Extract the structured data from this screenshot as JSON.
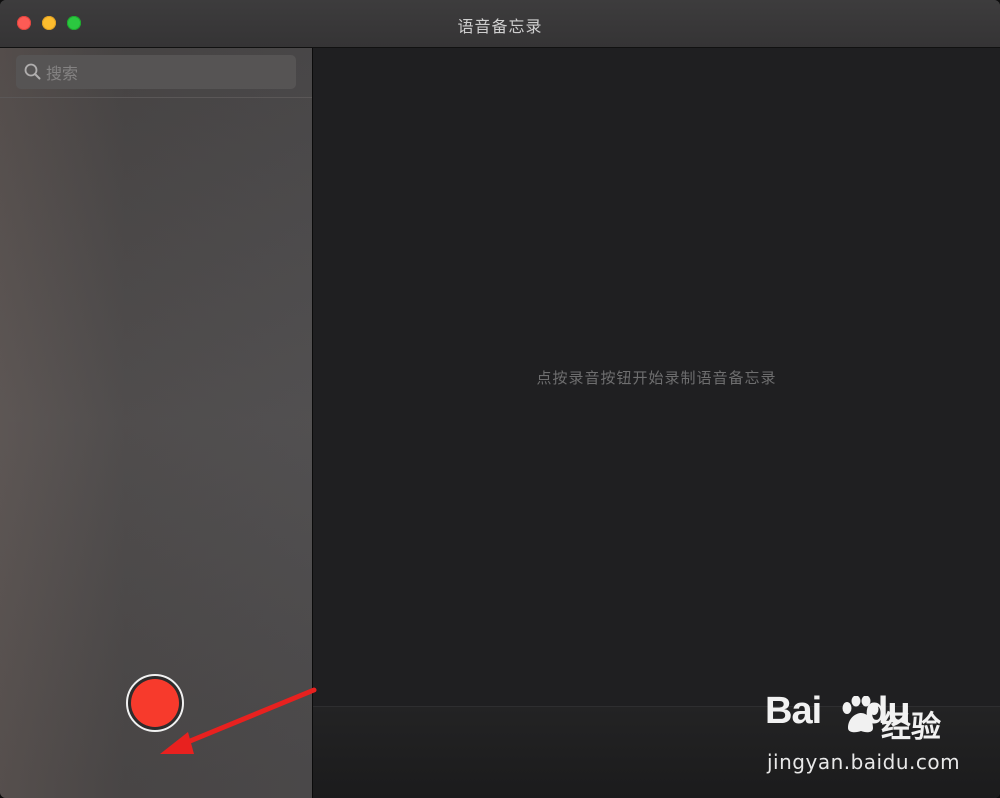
{
  "window": {
    "title": "语音备忘录"
  },
  "sidebar": {
    "search": {
      "placeholder": "搜索",
      "value": ""
    }
  },
  "main": {
    "empty_message": "点按录音按钮开始录制语音备忘录"
  },
  "record_button": {
    "color": "#f73a2c",
    "icon": "record-icon"
  },
  "watermark": {
    "logo_left": "Bai",
    "logo_right": "du",
    "logo_suffix": "经验",
    "url": "jingyan.baidu.com"
  },
  "colors": {
    "close": "#fd5b55",
    "minimize": "#fdbd2e",
    "maximize": "#2bc840",
    "annotation_arrow": "#e8211f"
  }
}
